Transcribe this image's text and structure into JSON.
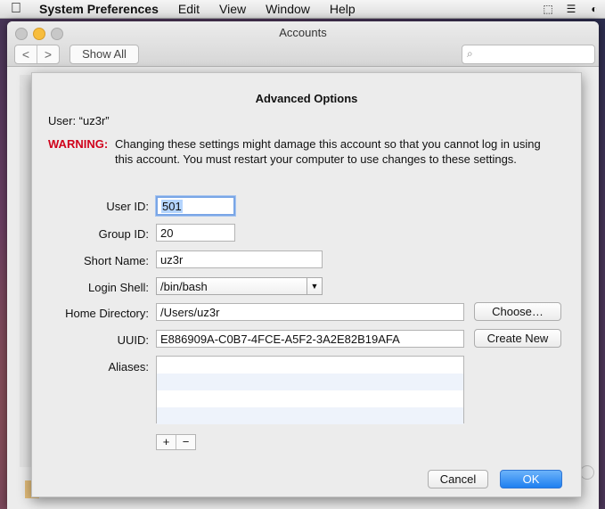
{
  "menubar": {
    "apple": "",
    "app_name": "System Preferences",
    "menus": [
      "Edit",
      "View",
      "Window",
      "Help"
    ],
    "status_icons": [
      "screen-selection-icon",
      "notes-icon",
      "color-picker-icon"
    ]
  },
  "window": {
    "title": "Accounts",
    "show_all": "Show All",
    "back": "<",
    "forward": ">",
    "search_placeholder": ""
  },
  "sheet": {
    "title": "Advanced Options",
    "user_line": "User: “uz3r”",
    "warning_label": "WARNING:",
    "warning_text": "Changing these settings might damage this account so that you cannot log in using this account. You must restart your computer to use changes to these settings.",
    "labels": {
      "user_id": "User ID:",
      "group_id": "Group ID:",
      "short_name": "Short Name:",
      "login_shell": "Login Shell:",
      "home_directory": "Home Directory:",
      "uuid": "UUID:",
      "aliases": "Aliases:"
    },
    "values": {
      "user_id": "501",
      "group_id": "20",
      "short_name": "uz3r",
      "login_shell": "/bin/bash",
      "home_directory": "/Users/uz3r",
      "uuid": "E886909A-C0B7-4FCE-A5F2-3A2E82B19AFA"
    },
    "buttons": {
      "choose": "Choose…",
      "create_new": "Create New",
      "add": "+",
      "remove": "−",
      "cancel": "Cancel",
      "ok": "OK"
    }
  }
}
